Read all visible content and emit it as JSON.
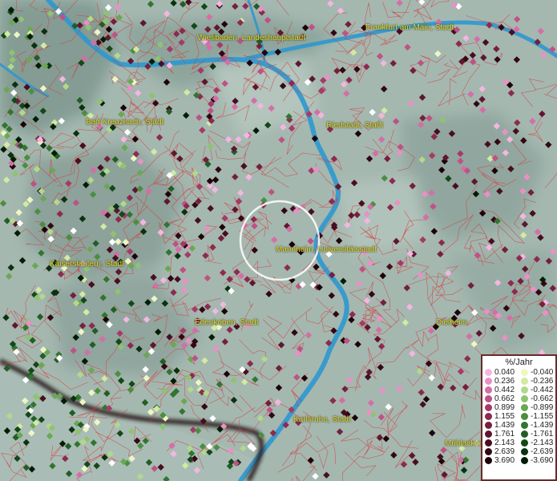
{
  "places": [
    {
      "name": "Wiesbaden, Landeshauptstadt"
    },
    {
      "name": "Frankfurt am Main, Stadt"
    },
    {
      "name": "Bad Kreuznach, Stadt"
    },
    {
      "name": "Riedstadt, Stadt"
    },
    {
      "name": "Kaiserslautern, Stadt"
    },
    {
      "name": "Mannheim, Universitätsstadt"
    },
    {
      "name": "Edenkoben, Stadt"
    },
    {
      "name": "Dielheim"
    },
    {
      "name": "Karlsruhe, Stadt"
    },
    {
      "name": "Mühlacker"
    }
  ],
  "legend": {
    "title": "%/Jahr",
    "positive": [
      {
        "label": "0.040",
        "color": "#f4b6e0"
      },
      {
        "label": "0.236",
        "color": "#e990c7"
      },
      {
        "label": "0.442",
        "color": "#d56ea6"
      },
      {
        "label": "0.662",
        "color": "#bf5285"
      },
      {
        "label": "0.899",
        "color": "#a63a67"
      },
      {
        "label": "1.155",
        "color": "#8d2a4f"
      },
      {
        "label": "1.439",
        "color": "#74203d"
      },
      {
        "label": "1.761",
        "color": "#5e172f"
      },
      {
        "label": "2.143",
        "color": "#480e20"
      },
      {
        "label": "2.639",
        "color": "#330714"
      },
      {
        "label": "3.690",
        "color": "#1d0209"
      }
    ],
    "negative": [
      {
        "label": "-0.040",
        "color": "#eef7c4"
      },
      {
        "label": "-0.236",
        "color": "#d2eaa2"
      },
      {
        "label": "-0.442",
        "color": "#b2d98a"
      },
      {
        "label": "-0.662",
        "color": "#8fc371"
      },
      {
        "label": "-0.899",
        "color": "#6aa854"
      },
      {
        "label": "-1.155",
        "color": "#4c8e40"
      },
      {
        "label": "-1.439",
        "color": "#337530"
      },
      {
        "label": "-1.761",
        "color": "#225e24"
      },
      {
        "label": "-2.143",
        "color": "#144818"
      },
      {
        "label": "-2.639",
        "color": "#0a320e"
      },
      {
        "label": "-3.690",
        "color": "#031d05"
      }
    ]
  },
  "colors": {
    "river": "#2e98cf",
    "boundary": "#d8373b",
    "state_border": "#2a1a1a",
    "label_text": "#e6df1f",
    "highlight_circle": "#ffffff"
  }
}
